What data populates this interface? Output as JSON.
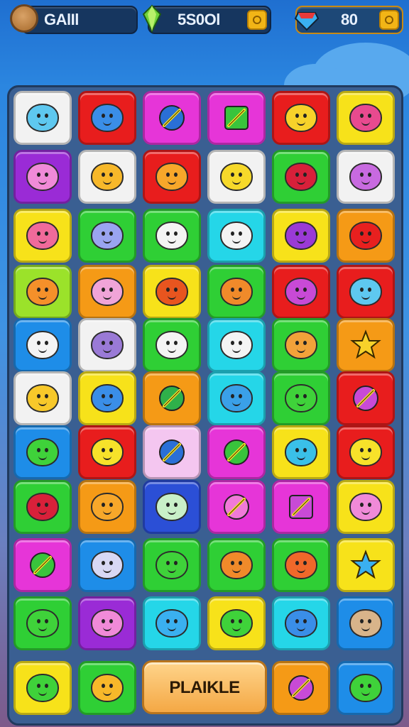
{
  "hud": {
    "player_name": "GAlIl",
    "score": "5S0Ol",
    "gems": "80"
  },
  "actions": {
    "place_label": "PLAIKLE"
  },
  "colors": {
    "white": "#f2f2f2",
    "red": "#e81d1d",
    "magenta": "#e635d8",
    "yellow": "#f7e21a",
    "purple": "#9a2bd6",
    "green": "#2fcf35",
    "cyan": "#25d6e8",
    "orange": "#f59a16",
    "lime": "#9be22a",
    "blue": "#1e8de8",
    "pink": "#f4c6f0",
    "navy": "#2b4fd6"
  },
  "board": {
    "columns": 6,
    "rows": [
      [
        {
          "bg": "white",
          "icon": "cat-face-icon",
          "fg": "#5ec8f0"
        },
        {
          "bg": "red",
          "icon": "blob-face-icon",
          "fg": "#3a8ee8"
        },
        {
          "bg": "magenta",
          "icon": "sword-orb-icon",
          "fg": "#2a6fd6"
        },
        {
          "bg": "magenta",
          "icon": "sword-square-icon",
          "fg": "#39c43c"
        },
        {
          "bg": "red",
          "icon": "chick-face-icon",
          "fg": "#f7d22a"
        },
        {
          "bg": "yellow",
          "icon": "gift-box-icon",
          "fg": "#e84a8f"
        }
      ],
      [
        {
          "bg": "purple",
          "icon": "pig-face-icon",
          "fg": "#f08ad8"
        },
        {
          "bg": "white",
          "icon": "blob-face-icon",
          "fg": "#f7b82a"
        },
        {
          "bg": "red",
          "icon": "sun-face-icon",
          "fg": "#f7a72a"
        },
        {
          "bg": "white",
          "icon": "blob-face-icon",
          "fg": "#f7d92a"
        },
        {
          "bg": "green",
          "icon": "heart-bag-icon",
          "fg": "#d8203a"
        },
        {
          "bg": "white",
          "icon": "blob-face-icon",
          "fg": "#c86ae0"
        }
      ],
      [
        {
          "bg": "yellow",
          "icon": "blob-face-icon",
          "fg": "#f06a9a"
        },
        {
          "bg": "green",
          "icon": "blob-face-icon",
          "fg": "#9aa4f0"
        },
        {
          "bg": "green",
          "icon": "ghost-icon",
          "fg": "#f4f4f4"
        },
        {
          "bg": "cyan",
          "icon": "ghost-icon",
          "fg": "#f4f4f4"
        },
        {
          "bg": "yellow",
          "icon": "blob-face-icon",
          "fg": "#9a3ad6"
        },
        {
          "bg": "orange",
          "icon": "blob-face-icon",
          "fg": "#e8201f"
        }
      ],
      [
        {
          "bg": "lime",
          "icon": "carrot-blob-icon",
          "fg": "#f5902a"
        },
        {
          "bg": "orange",
          "icon": "cow-face-icon",
          "fg": "#f0a4d8"
        },
        {
          "bg": "yellow",
          "icon": "crab-face-icon",
          "fg": "#e8551f"
        },
        {
          "bg": "green",
          "icon": "crab-face-icon",
          "fg": "#f08a2a"
        },
        {
          "bg": "red",
          "icon": "cat-face-icon",
          "fg": "#c84ad6"
        },
        {
          "bg": "red",
          "icon": "cat-face-icon",
          "fg": "#5ec8f0"
        }
      ],
      [
        {
          "bg": "blue",
          "icon": "blob-face-icon",
          "fg": "#f4f4f4"
        },
        {
          "bg": "white",
          "icon": "tulip-icon",
          "fg": "#9a7ad6"
        },
        {
          "bg": "green",
          "icon": "blob-face-icon",
          "fg": "#f4f4f4"
        },
        {
          "bg": "cyan",
          "icon": "ghost-icon",
          "fg": "#f4f4f4"
        },
        {
          "bg": "green",
          "icon": "blob-face-icon",
          "fg": "#f2a23a"
        },
        {
          "bg": "orange",
          "icon": "star-icon",
          "fg": "#f7d22a"
        }
      ],
      [
        {
          "bg": "white",
          "icon": "blob-face-icon",
          "fg": "#f7c82a"
        },
        {
          "bg": "yellow",
          "icon": "blob-face-icon",
          "fg": "#3a8ee8"
        },
        {
          "bg": "orange",
          "icon": "sword-orb-icon",
          "fg": "#2fb04a"
        },
        {
          "bg": "cyan",
          "icon": "robot-face-icon",
          "fg": "#3aa0e8"
        },
        {
          "bg": "green",
          "icon": "leaf-face-icon",
          "fg": "#3fd23a"
        },
        {
          "bg": "red",
          "icon": "sword-orb-icon",
          "fg": "#c84ad6"
        }
      ],
      [
        {
          "bg": "blue",
          "icon": "leaf-face-icon",
          "fg": "#3fd23a"
        },
        {
          "bg": "red",
          "icon": "blob-face-icon",
          "fg": "#f7e22a"
        },
        {
          "bg": "pink",
          "icon": "sword-orb-icon",
          "fg": "#2a6fd6"
        },
        {
          "bg": "magenta",
          "icon": "sword-orb-icon",
          "fg": "#39c43c"
        },
        {
          "bg": "yellow",
          "icon": "robot-face-icon",
          "fg": "#3ac0e8"
        },
        {
          "bg": "red",
          "icon": "blob-face-icon",
          "fg": "#f7e22a"
        }
      ],
      [
        {
          "bg": "green",
          "icon": "heart-bag-icon",
          "fg": "#d8203a"
        },
        {
          "bg": "orange",
          "icon": "sun-face-icon",
          "fg": "#f7a72a"
        },
        {
          "bg": "navy",
          "icon": "dumpling-icon",
          "fg": "#c8f0c8"
        },
        {
          "bg": "magenta",
          "icon": "sword-orb-icon",
          "fg": "#f07ad8"
        },
        {
          "bg": "magenta",
          "icon": "sword-square-icon",
          "fg": "#c84ad6"
        },
        {
          "bg": "yellow",
          "icon": "ghost-hand-icon",
          "fg": "#f08ad8"
        }
      ],
      [
        {
          "bg": "magenta",
          "icon": "leaf-sword-icon",
          "fg": "#39c43c"
        },
        {
          "bg": "blue",
          "icon": "blob-face-icon",
          "fg": "#d8d8f4"
        },
        {
          "bg": "green",
          "icon": "leaf-face-icon",
          "fg": "#3fd23a"
        },
        {
          "bg": "green",
          "icon": "crab-face-icon",
          "fg": "#f08a2a"
        },
        {
          "bg": "green",
          "icon": "crab-face-icon",
          "fg": "#f0682a"
        },
        {
          "bg": "yellow",
          "icon": "star-icon",
          "fg": "#3ab0f0"
        }
      ],
      [
        {
          "bg": "green",
          "icon": "leaf-face-icon",
          "fg": "#3fd23a"
        },
        {
          "bg": "purple",
          "icon": "pig-face-icon",
          "fg": "#f08ad8"
        },
        {
          "bg": "cyan",
          "icon": "blob-face-icon",
          "fg": "#3ab0f0"
        },
        {
          "bg": "yellow",
          "icon": "leaf-blob-icon",
          "fg": "#3fd23a"
        },
        {
          "bg": "cyan",
          "icon": "blob-face-icon",
          "fg": "#3a8ee8"
        },
        {
          "bg": "blue",
          "icon": "bear-face-icon",
          "fg": "#d8b48a"
        }
      ]
    ],
    "bottom_row": [
      {
        "bg": "yellow",
        "icon": "leaf-blob-icon",
        "fg": "#3fd23a"
      },
      {
        "bg": "green",
        "icon": "blob-face-icon",
        "fg": "#f7b82a"
      },
      {
        "bg": "orange",
        "icon": "sword-orb-icon",
        "fg": "#c84ad6"
      },
      {
        "bg": "blue",
        "icon": "leaf-face-icon",
        "fg": "#3fd23a"
      }
    ]
  }
}
